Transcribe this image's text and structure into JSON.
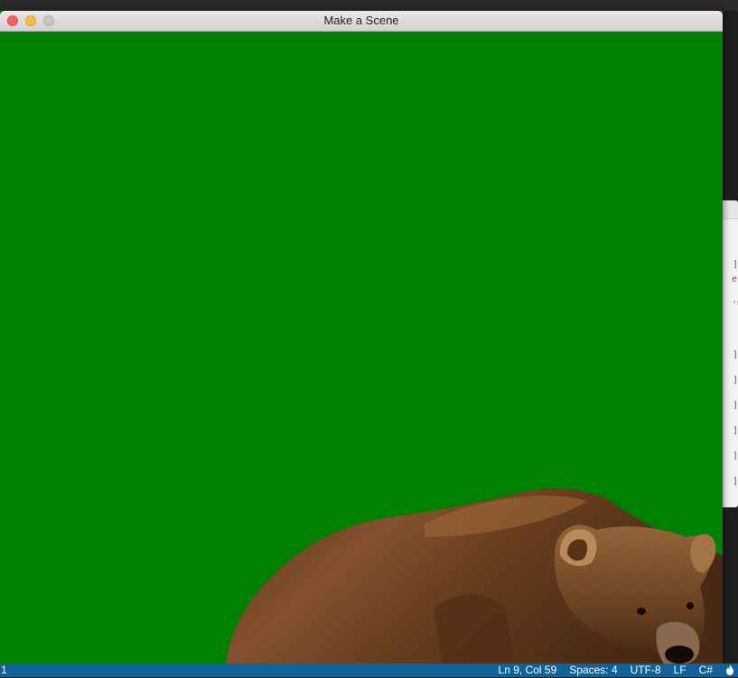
{
  "window": {
    "title": "Make a Scene",
    "controls": [
      "close",
      "minimize",
      "maximize"
    ]
  },
  "scene": {
    "background_color": "#008000",
    "sprite": "bear"
  },
  "statusbar": {
    "left_text": "1",
    "position": "Ln 9, Col 59",
    "indent": "Spaces: 4",
    "encoding": "UTF-8",
    "line_ending": "LF",
    "language": "C#",
    "extra_icon": "flame-icon",
    "color": "#0e639c"
  },
  "background_editor": {
    "snippet_a": "e",
    "snippet_b": "'U"
  }
}
